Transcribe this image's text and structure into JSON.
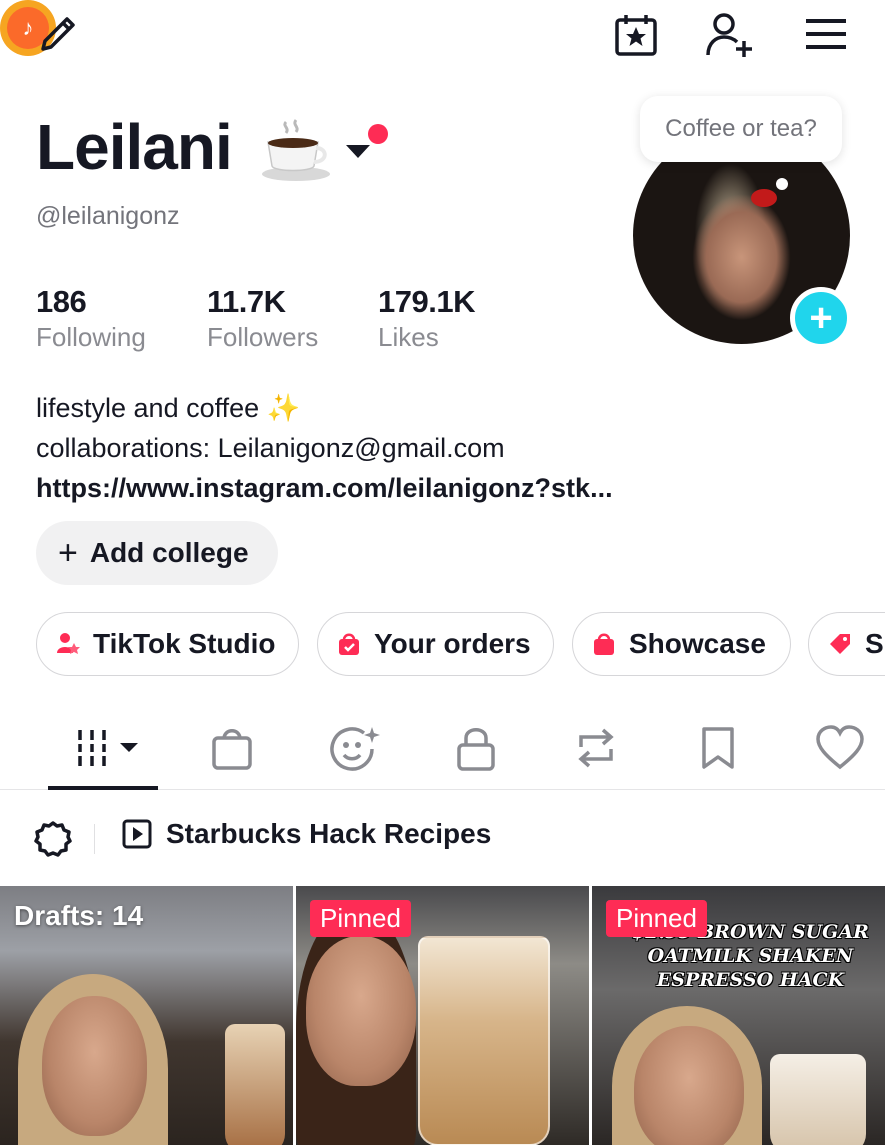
{
  "topbar": {
    "icons": [
      "pencil-icon",
      "tiktok-coin-icon",
      "calendar-star-icon",
      "add-user-icon",
      "menu-icon"
    ]
  },
  "profile": {
    "name": "Leilani",
    "name_emoji": "☕",
    "handle": "@leilanigonz",
    "status_bubble": "Coffee or tea?",
    "stats": [
      {
        "value": "186",
        "label": "Following"
      },
      {
        "value": "11.7K",
        "label": "Followers"
      },
      {
        "value": "179.1K",
        "label": "Likes"
      }
    ],
    "bio_line1": "lifestyle and coffee ✨",
    "bio_line2": "collaborations: Leilanigonz@gmail.com",
    "bio_link": "https://www.instagram.com/leilanigonz?stk..."
  },
  "college_button": {
    "plus": "+",
    "label": "Add college"
  },
  "chips": [
    {
      "label": "TikTok Studio",
      "icon": "studio-icon"
    },
    {
      "label": "Your orders",
      "icon": "orders-bag-icon"
    },
    {
      "label": "Showcase",
      "icon": "showcase-bag-icon"
    },
    {
      "label": "S",
      "icon": "tag-icon"
    }
  ],
  "tabs": [
    "videos-grid-icon",
    "shop-bag-icon",
    "ai-face-icon",
    "lock-icon",
    "repost-icon",
    "bookmark-icon",
    "heart-icon"
  ],
  "playlist": {
    "label": "Starbucks Hack Recipes"
  },
  "grid": [
    {
      "overlay": "Drafts: 14"
    },
    {
      "badge": "Pinned"
    },
    {
      "badge": "Pinned",
      "caption_line1": "$2.95 BROWN SUGAR",
      "caption_line2": "OATMILK SHAKEN",
      "caption_line3": "ESPRESSO HACK"
    }
  ],
  "colors": {
    "accent": "#fe2c55",
    "plus": "#20d5ec",
    "muted": "#73747b"
  }
}
